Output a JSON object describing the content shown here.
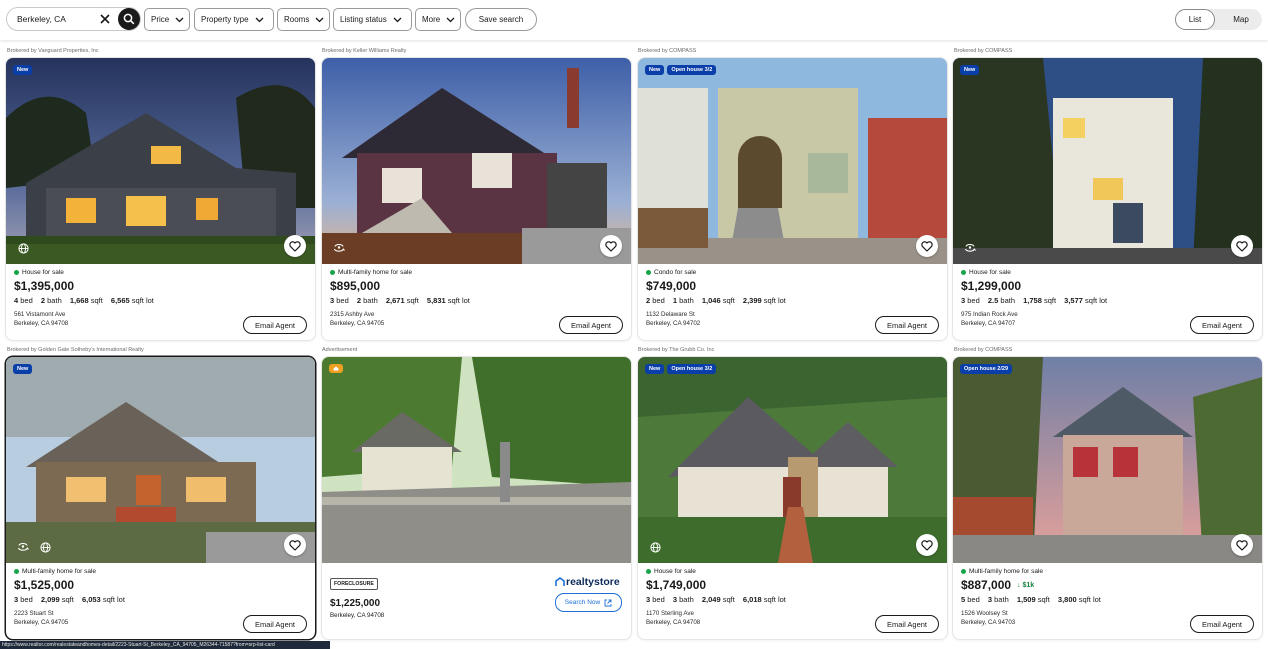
{
  "search": {
    "value": "Berkeley, CA"
  },
  "filters": {
    "price": "Price",
    "property_type": "Property type",
    "rooms": "Rooms",
    "listing_status": "Listing status",
    "more": "More",
    "save_search": "Save search"
  },
  "view_toggle": {
    "list": "List",
    "map": "Map",
    "active": "List"
  },
  "listings": [
    {
      "broker": "Brokered by Vanguard Properties, Inc",
      "badges": [
        "New"
      ],
      "type": "House for sale",
      "price": "$1,395,000",
      "bed": "4",
      "bath": "2",
      "sqft": "1,668",
      "lot": "6,565",
      "address1": "561 Vistamont Ave",
      "address2": "Berkeley, CA 94708",
      "email": "Email Agent",
      "icons": [
        "globe-icon"
      ]
    },
    {
      "broker": "Brokered by Keller Williams Realty",
      "badges": [],
      "type": "Multi-family home for sale",
      "price": "$895,000",
      "bed": "3",
      "bath": "2",
      "sqft": "2,671",
      "lot": "5,831",
      "address1": "2315 Ashby Ave",
      "address2": "Berkeley, CA 94705",
      "email": "Email Agent",
      "icons": [
        "3d-tour-icon"
      ]
    },
    {
      "broker": "Brokered by COMPASS",
      "badges": [
        "New",
        "Open house 3/2"
      ],
      "type": "Condo for sale",
      "price": "$749,000",
      "bed": "2",
      "bath": "1",
      "sqft": "1,046",
      "lot": "2,399",
      "address1": "1132 Delaware St",
      "address2": "Berkeley, CA 94702",
      "email": "Email Agent",
      "icons": []
    },
    {
      "broker": "Brokered by COMPASS",
      "badges": [
        "New"
      ],
      "type": "House for sale",
      "price": "$1,299,000",
      "bed": "3",
      "bath": "2.5",
      "sqft": "1,758",
      "lot": "3,577",
      "address1": "975 Indian Rock Ave",
      "address2": "Berkeley, CA 94707",
      "email": "Email Agent",
      "icons": [
        "3d-tour-icon"
      ]
    },
    {
      "broker": "Brokered by Golden Gate Sotheby's International Realty",
      "badges": [
        "New"
      ],
      "type": "Multi-family home for sale",
      "price": "$1,525,000",
      "bed": "3",
      "bath": "",
      "sqft": "2,099",
      "lot": "6,053",
      "address1": "2223 Stuart St",
      "address2": "Berkeley, CA 94705",
      "email": "Email Agent",
      "icons": [
        "3d-tour-icon",
        "globe-icon"
      ]
    },
    {
      "broker": "Brokered by The Grubb Co. Inc",
      "badges": [
        "New",
        "Open house 3/2"
      ],
      "type": "House for sale",
      "price": "$1,749,000",
      "bed": "3",
      "bath": "3",
      "sqft": "2,049",
      "lot": "6,018",
      "address1": "1170 Sterling Ave",
      "address2": "Berkeley, CA 94708",
      "email": "Email Agent",
      "icons": [
        "globe-icon"
      ]
    },
    {
      "broker": "Brokered by COMPASS",
      "badges": [
        "Open house 2/29"
      ],
      "type": "Multi-family home for sale",
      "price": "$887,000",
      "price_cut": "↓ $1k",
      "bed": "5",
      "bath": "3",
      "sqft": "1,509",
      "lot": "3,800",
      "address1": "1526 Woolsey St",
      "address2": "Berkeley, CA 94703",
      "email": "Email Agent",
      "icons": []
    }
  ],
  "labels": {
    "bed": "bed",
    "bath": "bath",
    "sqft": "sqft",
    "lot": "sqft lot"
  },
  "advertisement": {
    "label": "Advertisement",
    "tag": "FORECLOSURE",
    "price": "$1,225,000",
    "address": "Berkeley, CA 94708",
    "brand": "realtystore",
    "cta": "Search Now"
  },
  "status_url": "https://www.realtor.com/realestateandhomes-detail/2223-Stuart-St_Berkeley_CA_94705_M26344-71587?from=srp-list-card",
  "colors": {
    "badge": "#0a3ea8",
    "for_sale_dot": "#17a34a",
    "link": "#1d6fd6"
  }
}
